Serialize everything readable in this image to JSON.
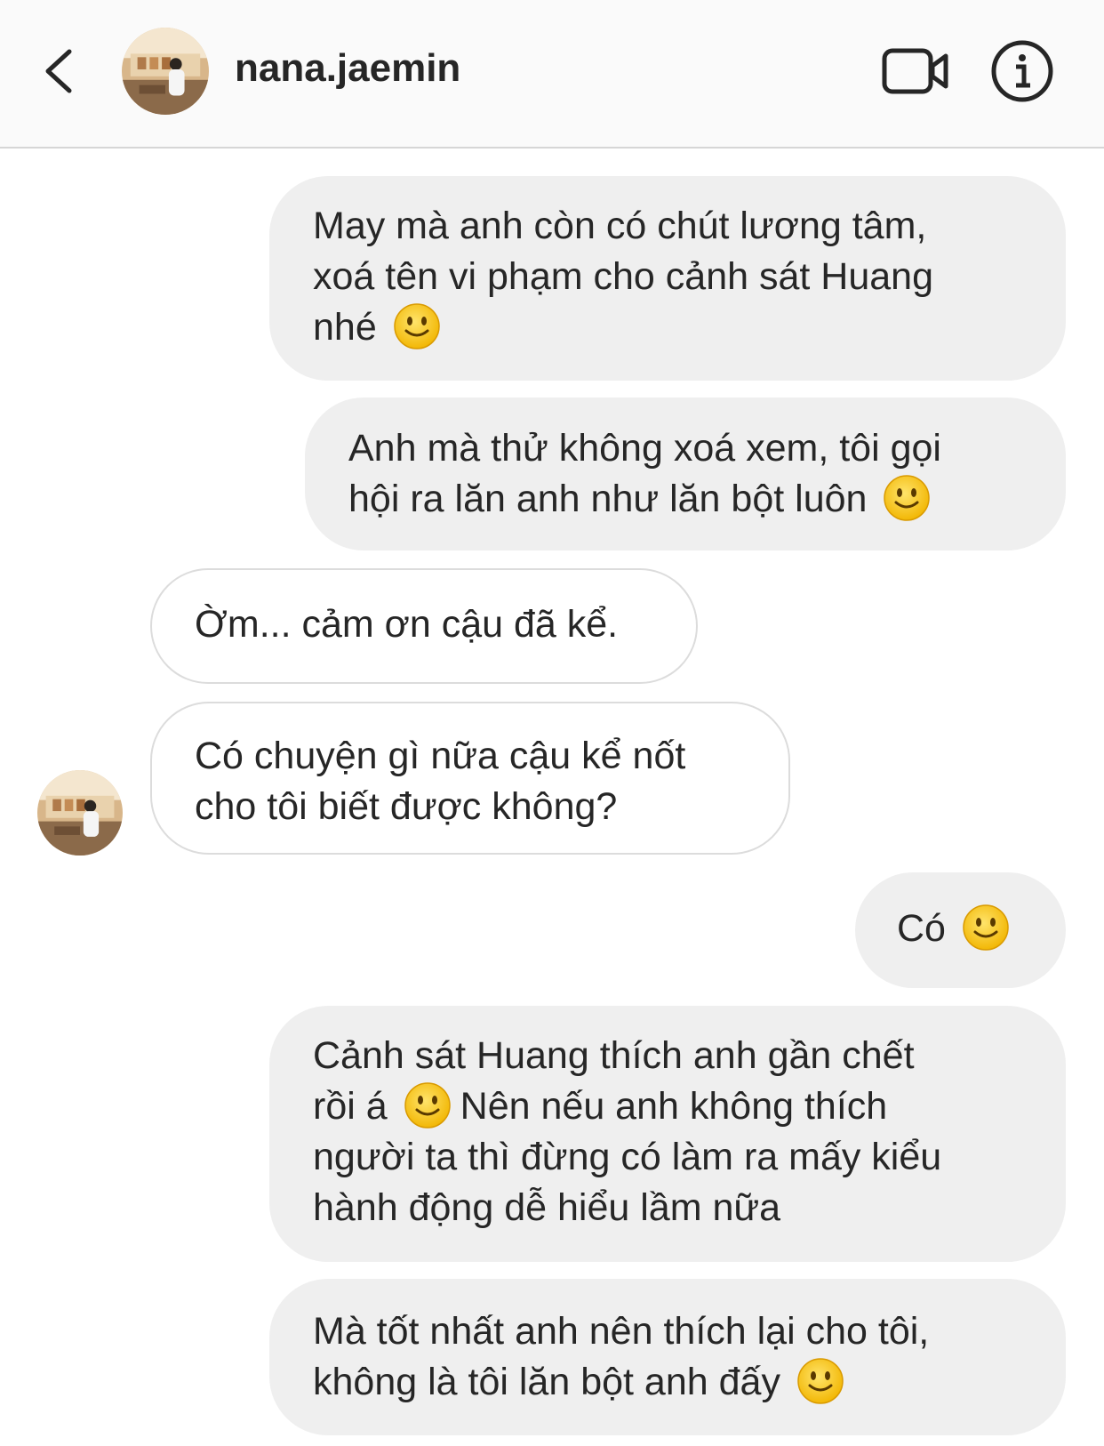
{
  "header": {
    "username": "nana.jaemin",
    "back_icon": "chevron-left-icon",
    "video_icon": "video-camera-icon",
    "info_icon": "info-icon",
    "avatar": "profile-photo"
  },
  "messages": [
    {
      "side": "outgoing",
      "lines": [
        "May mà anh còn có chút lương tâm,",
        "xoá tên vi phạm cho cảnh sát Huang",
        "nhé"
      ]
    },
    {
      "side": "outgoing",
      "lines": [
        "Anh mà thử không xoá xem, tôi gọi",
        "hội ra lăn anh như lăn bột luôn"
      ]
    },
    {
      "side": "incoming",
      "lines": [
        "Ờm... cảm ơn cậu đã kể."
      ]
    },
    {
      "side": "incoming",
      "lines": [
        "Có chuyện gì nữa cậu kể nốt",
        "cho tôi biết được không?"
      ]
    },
    {
      "side": "outgoing",
      "lines": [
        "Có"
      ]
    },
    {
      "side": "outgoing",
      "lines": [
        "Cảnh sát Huang thích anh gần chết",
        "rồi á",
        "Nên nếu anh không thích",
        "người ta thì đừng có làm ra mấy kiểu",
        "hành động dễ hiểu lầm nữa"
      ]
    },
    {
      "side": "outgoing",
      "lines": [
        "Mà tốt nhất anh nên thích lại cho tôi,",
        "không là tôi lăn bột anh đấy"
      ]
    }
  ],
  "emoji": "slightly-smiling-face-icon",
  "colors": {
    "header_bg": "#fafafa",
    "outgoing_bubble": "#efefef",
    "incoming_border": "#dcdcdc",
    "text": "#262626",
    "emoji_yellow": "#f5c518"
  }
}
